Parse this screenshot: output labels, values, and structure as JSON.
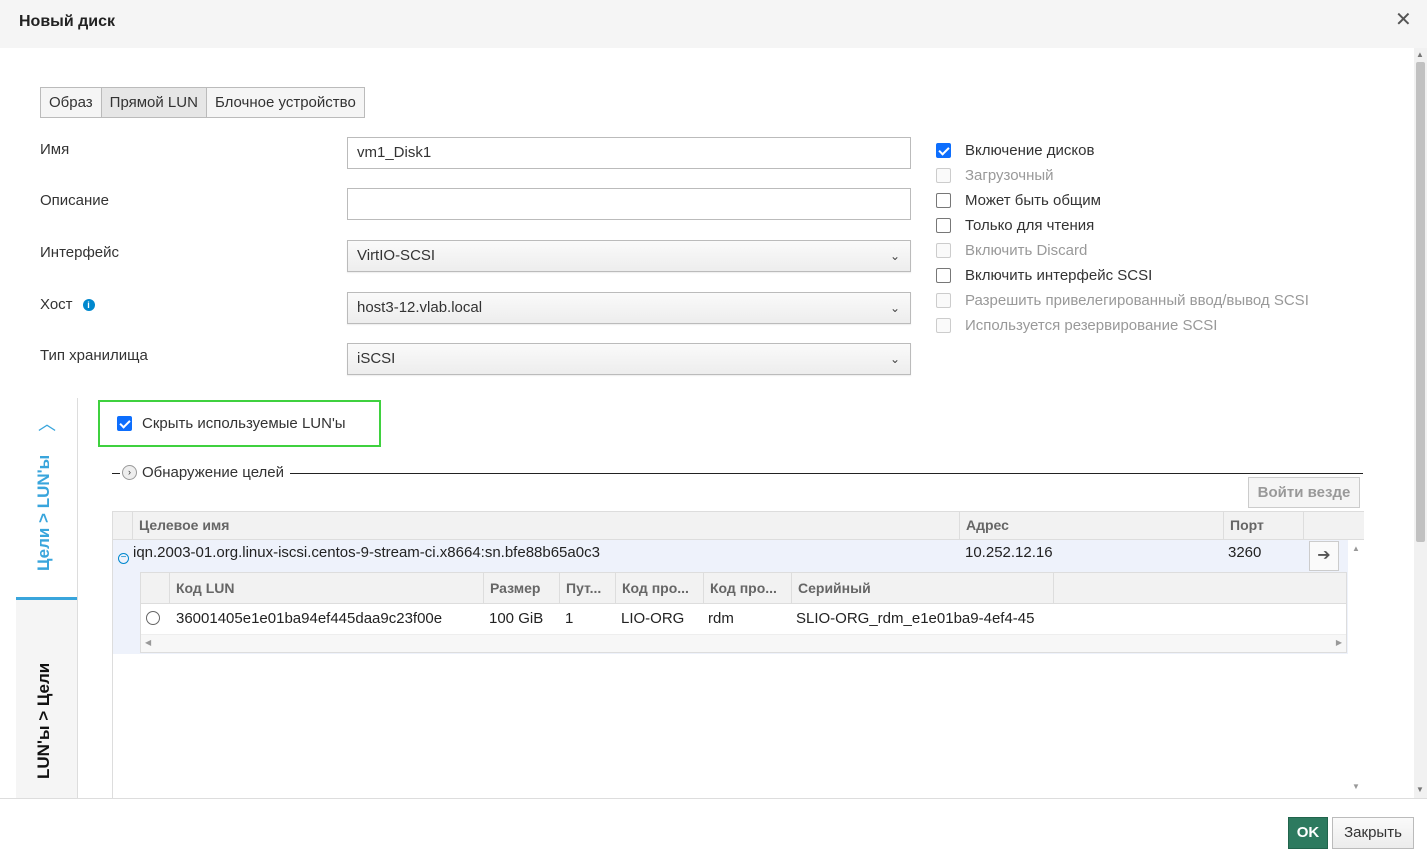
{
  "dialog": {
    "title": "Новый диск",
    "close_glyph": "✕"
  },
  "tabs": [
    {
      "label": "Образ",
      "active": false
    },
    {
      "label": "Прямой LUN",
      "active": true
    },
    {
      "label": "Блочное устройство",
      "active": false
    }
  ],
  "form": {
    "name_label": "Имя",
    "name_value": "vm1_Disk1",
    "description_label": "Описание",
    "description_value": "",
    "interface_label": "Интерфейс",
    "interface_value": "VirtIO-SCSI",
    "host_label": "Хост",
    "host_value": "host3-12.vlab.local",
    "storage_type_label": "Тип хранилища",
    "storage_type_value": "iSCSI"
  },
  "options": [
    {
      "label": "Включение дисков",
      "checked": true,
      "disabled": false
    },
    {
      "label": "Загрузочный",
      "checked": false,
      "disabled": true
    },
    {
      "label": "Может быть общим",
      "checked": false,
      "disabled": false
    },
    {
      "label": "Только для чтения",
      "checked": false,
      "disabled": false
    },
    {
      "label": "Включить Discard",
      "checked": false,
      "disabled": true
    },
    {
      "label": "Включить интерфейс SCSI",
      "checked": false,
      "disabled": false
    },
    {
      "label": "Разрешить привелегированный ввод/вывод SCSI",
      "checked": false,
      "disabled": true
    },
    {
      "label": "Используется резервирование SCSI",
      "checked": false,
      "disabled": true
    }
  ],
  "side_tabs": {
    "targets_luns": "Цели > LUN'ы",
    "luns_targets": "LUN'ы > Цели"
  },
  "hide_used": {
    "label": "Скрыть используемые LUN'ы",
    "checked": true
  },
  "discovery": {
    "label": "Обнаружение целей",
    "login_all": "Войти везде"
  },
  "targets_table": {
    "headers": {
      "target": "Целевое имя",
      "address": "Адрес",
      "port": "Порт"
    },
    "row": {
      "target": "iqn.2003-01.org.linux-iscsi.centos-9-stream-ci.x8664:sn.bfe88b65a0c3",
      "address": "10.252.12.16",
      "port": "3260"
    }
  },
  "lun_table": {
    "headers": {
      "lun_id": "Код LUN",
      "size": "Размер",
      "paths": "Пут...",
      "vendor": "Код про...",
      "product": "Код про...",
      "serial": "Серийный"
    },
    "row": {
      "lun_id": "36001405e1e01ba94ef445daa9c23f00e",
      "size": "100 GiB",
      "paths": "1",
      "vendor": "LIO-ORG",
      "product": "rdm",
      "serial": "SLIO-ORG_rdm_e1e01ba9-4ef4-45"
    }
  },
  "footer": {
    "ok": "OK",
    "close": "Закрыть"
  }
}
